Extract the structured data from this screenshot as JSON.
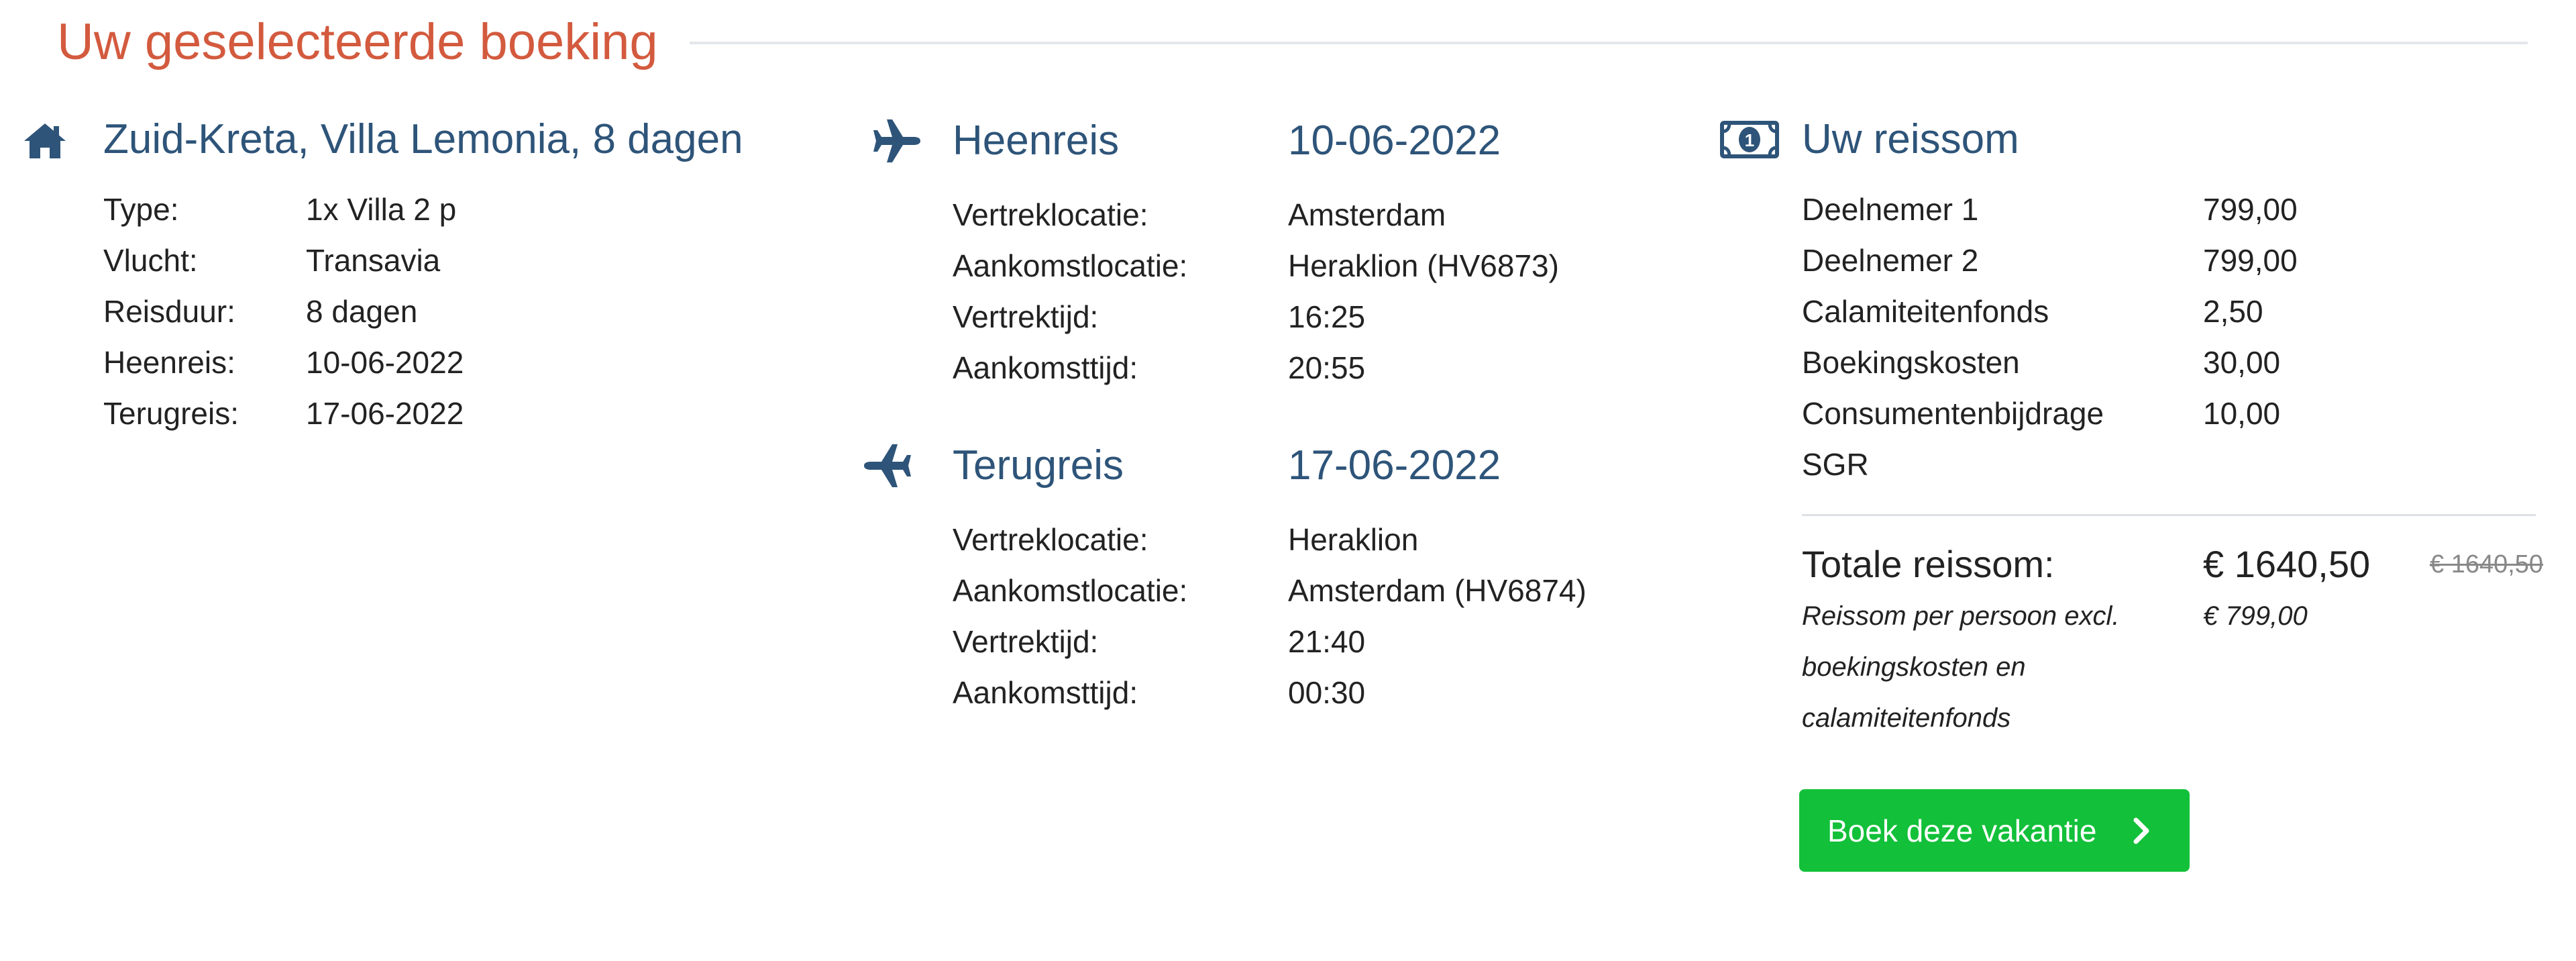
{
  "page_title": "Uw geselecteerde boeking",
  "accommodation": {
    "title": "Zuid-Kreta, Villa Lemonia, 8 dagen",
    "rows": [
      {
        "label": "Type:",
        "value": "1x Villa 2 p"
      },
      {
        "label": "Vlucht:",
        "value": "Transavia"
      },
      {
        "label": "Reisduur:",
        "value": "8 dagen"
      },
      {
        "label": "Heenreis:",
        "value": "10-06-2022"
      },
      {
        "label": "Terugreis:",
        "value": "17-06-2022"
      }
    ]
  },
  "outbound": {
    "title": "Heenreis",
    "date": "10-06-2022",
    "rows": [
      {
        "label": "Vertreklocatie:",
        "value": "Amsterdam"
      },
      {
        "label": "Aankomstlocatie:",
        "value": "Heraklion (HV6873)"
      },
      {
        "label": "Vertrektijd:",
        "value": "16:25"
      },
      {
        "label": "Aankomsttijd:",
        "value": "20:55"
      }
    ]
  },
  "return": {
    "title": "Terugreis",
    "date": "17-06-2022",
    "rows": [
      {
        "label": "Vertreklocatie:",
        "value": "Heraklion"
      },
      {
        "label": "Aankomstlocatie:",
        "value": "Amsterdam (HV6874)"
      },
      {
        "label": "Vertrektijd:",
        "value": "21:40"
      },
      {
        "label": "Aankomsttijd:",
        "value": "00:30"
      }
    ]
  },
  "price": {
    "title": "Uw reissom",
    "rows": [
      {
        "label": "Deelnemer 1",
        "value": "799,00"
      },
      {
        "label": "Deelnemer 2",
        "value": "799,00"
      },
      {
        "label": "Calamiteitenfonds",
        "value": "2,50"
      },
      {
        "label": "Boekingskosten",
        "value": "30,00"
      },
      {
        "label": "Consumentenbijdrage",
        "value": "10,00"
      },
      {
        "label": "SGR",
        "value": ""
      }
    ],
    "total_label": "Totale reissom:",
    "total_value": "€ 1640,50",
    "total_old": "€ 1640,50",
    "note": "Reissom per persoon excl. boekingskosten en calamiteitenfonds",
    "per_person": "€ 799,00",
    "button_label": "Boek deze vakantie"
  },
  "colors": {
    "accent": "#d35a3e",
    "heading": "#2e5479",
    "button": "#12c039"
  },
  "icons": {
    "accommodation": "home-icon",
    "outbound": "plane-icon",
    "return": "plane-return-icon",
    "price": "money-icon",
    "button": "chevron-right-icon"
  }
}
